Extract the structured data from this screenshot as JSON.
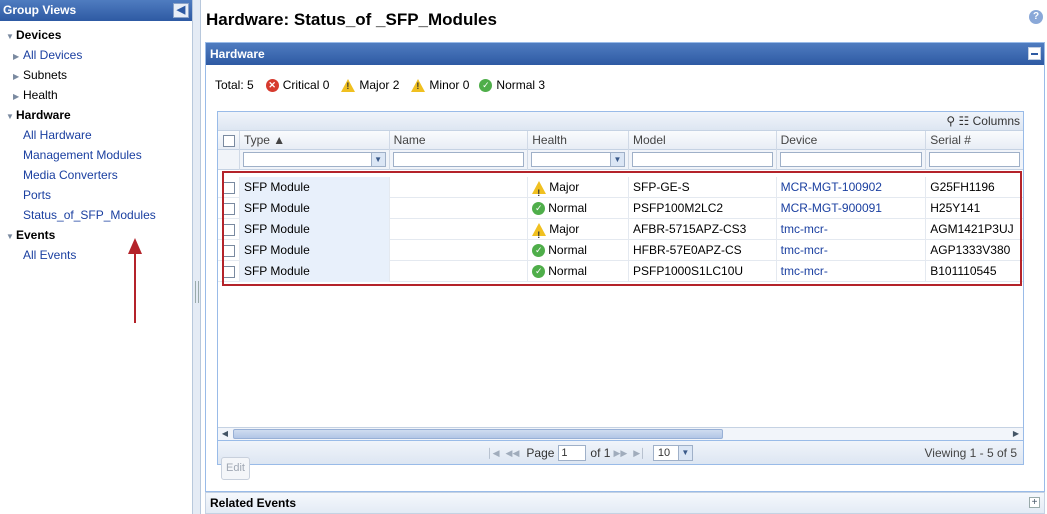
{
  "sidebar": {
    "title": "Group Views",
    "sections": {
      "devices": "Devices",
      "hardware": "Hardware",
      "events": "Events"
    },
    "devices_items": [
      "All Devices",
      "Subnets",
      "Health"
    ],
    "hardware_items": [
      "All Hardware",
      "Management Modules",
      "Media Converters",
      "Ports",
      "Status_of_SFP_Modules"
    ],
    "events_items": [
      "All Events"
    ]
  },
  "page_title": "Hardware: Status_of _SFP_Modules",
  "panel": {
    "title": "Hardware",
    "summary": {
      "total": "Total: 5",
      "critical": "Critical 0",
      "major": "Major 2",
      "minor": "Minor 0",
      "normal": "Normal 3"
    },
    "columns_label": "Columns",
    "headers": [
      "Type ▲",
      "Name",
      "Health",
      "Model",
      "Device",
      "Serial #"
    ],
    "rows": [
      {
        "type": "SFP Module",
        "name": "",
        "health": "Major",
        "model": "SFP-GE-S",
        "device": "MCR-MGT-100902",
        "serial": "G25FH1196"
      },
      {
        "type": "SFP Module",
        "name": "",
        "health": "Normal",
        "model": "PSFP100M2LC2",
        "device": "MCR-MGT-900091",
        "serial": "H25Y141"
      },
      {
        "type": "SFP Module",
        "name": "",
        "health": "Major",
        "model": "AFBR-5715APZ-CS3",
        "device": "tmc-mcr-",
        "serial": "AGM1421P3UJ"
      },
      {
        "type": "SFP Module",
        "name": "",
        "health": "Normal",
        "model": "HFBR-57E0APZ-CS",
        "device": "tmc-mcr-",
        "serial": "AGP1333V380"
      },
      {
        "type": "SFP Module",
        "name": "",
        "health": "Normal",
        "model": "PSFP1000S1LC10U",
        "device": "tmc-mcr-",
        "serial": "B101110545"
      }
    ],
    "pager": {
      "page_label": "Page",
      "page_value": "1",
      "of_label": "of 1",
      "per_page": "10",
      "viewing": "Viewing 1 - 5 of 5"
    },
    "edit_label": "Edit"
  },
  "related_events": "Related Events",
  "colors": {
    "header_blue": "#2e5aa3",
    "link": "#1a3fa0",
    "highlight_border": "#b4232a",
    "critical": "#d63a2e",
    "major": "#f0c020",
    "normal": "#4fae4a"
  }
}
